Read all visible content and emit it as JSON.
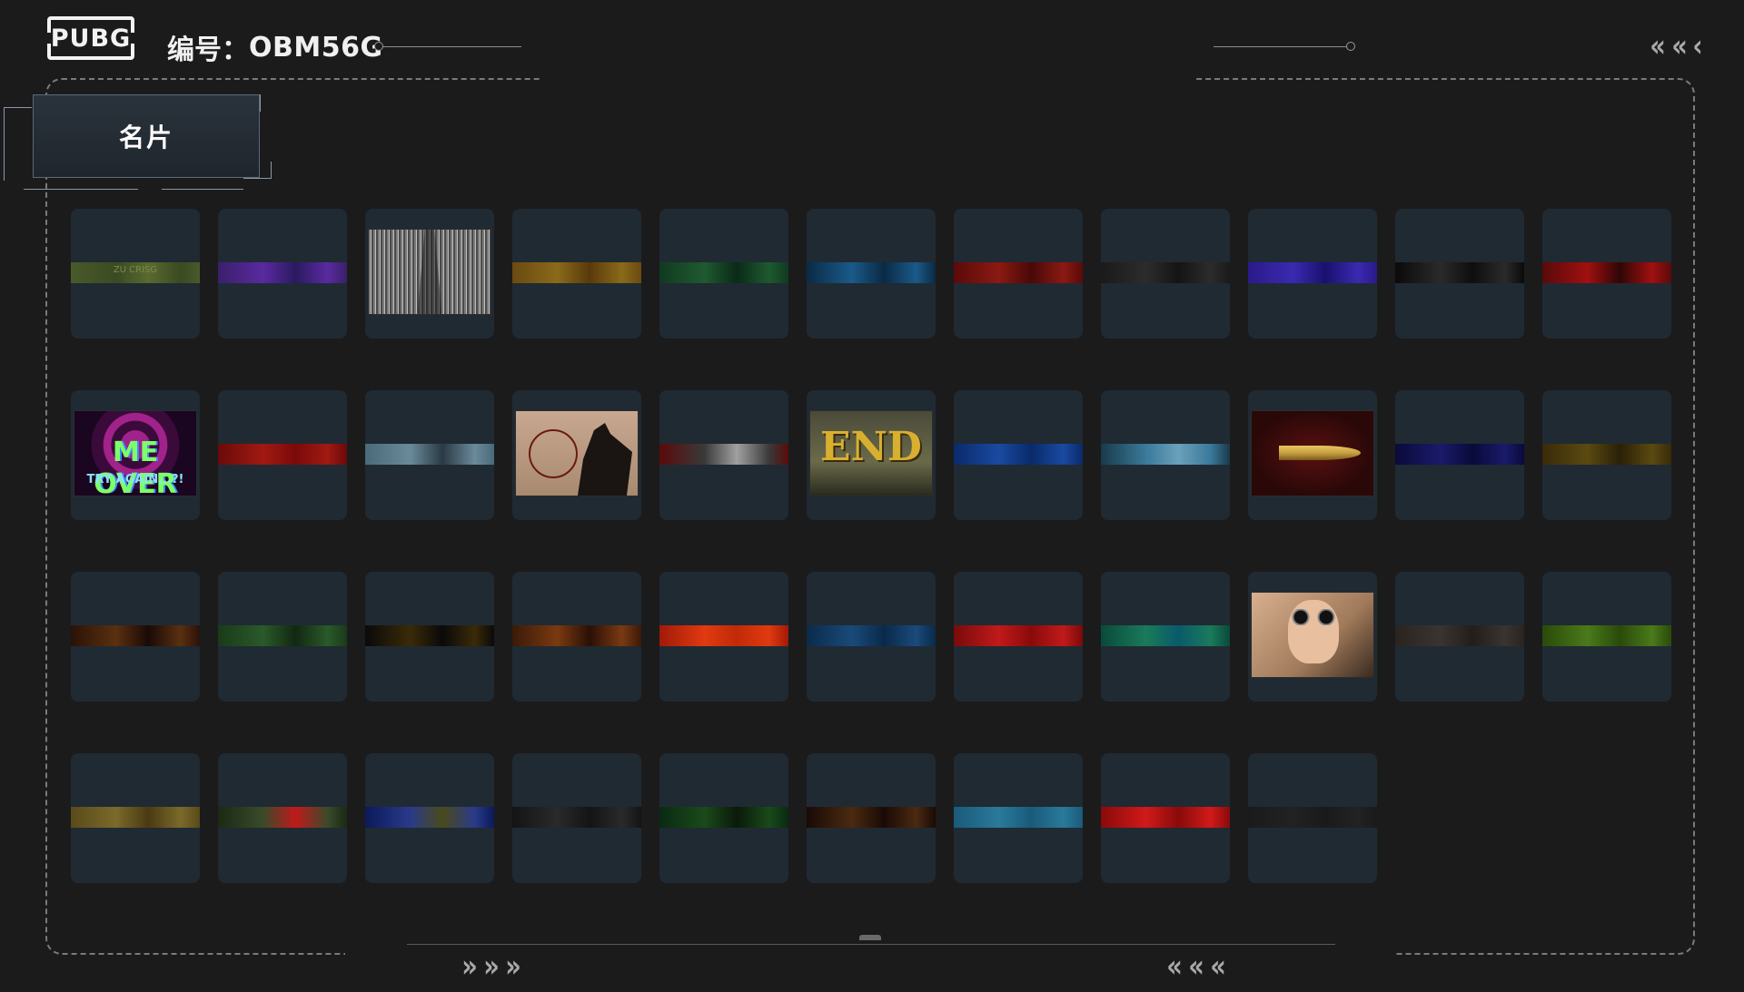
{
  "header": {
    "logo_text": "PUBG",
    "id_label": "编号：",
    "id_value": "OBM56G"
  },
  "tab": {
    "label": "名片"
  },
  "colors": {
    "background": "#1b1b1c",
    "card": "#202a33",
    "frame": "#7a7a7a"
  },
  "icons": {
    "back": "double-chevron-left-icon",
    "nav_right": "chevron-right-icon",
    "nav_left": "chevron-left-icon"
  },
  "cards": [
    {
      "stripe": [
        "#4a5a2a",
        "#3a4a22",
        "#5a6a30"
      ],
      "stripe_text": "ZU CRISG"
    },
    {
      "stripe": [
        "#3a1f6a",
        "#5a2aa0",
        "#2a1a60"
      ]
    },
    {
      "image": "noise",
      "colors": [
        "#7a7a7a",
        "#bdbdbd",
        "#4a4a4a"
      ]
    },
    {
      "stripe": [
        "#6a4a10",
        "#8a6a1a",
        "#5a3a0a"
      ]
    },
    {
      "stripe": [
        "#103a20",
        "#1f5a30",
        "#0a2a18"
      ]
    },
    {
      "stripe": [
        "#0a2a45",
        "#1a5a8a",
        "#0a2a45"
      ]
    },
    {
      "stripe": [
        "#5a0a0a",
        "#8a1a12",
        "#4a0808"
      ]
    },
    {
      "stripe": [
        "#1a1a1a",
        "#2c2c2c",
        "#141414"
      ]
    },
    {
      "stripe": [
        "#2a1a8a",
        "#3a2ab0",
        "#1a1070"
      ]
    },
    {
      "stripe": [
        "#0a0a0a",
        "#2a2a2a",
        "#0e0e0e"
      ]
    },
    {
      "stripe": [
        "#5a0a0a",
        "#a01010",
        "#300606"
      ]
    },
    {
      "image": "gameover",
      "text": "ME OVER",
      "subtext": "TRY AGAIN...?!",
      "colors": [
        "#3a0a3a",
        "#a0228a",
        "#1a0620"
      ]
    },
    {
      "stripe": [
        "#6a0a0a",
        "#a01a12",
        "#7a0a0a"
      ]
    },
    {
      "stripe": [
        "#4a6a7a",
        "#6a8a9a",
        "#2a3a44"
      ]
    },
    {
      "image": "sniper",
      "colors": [
        "#a88a70",
        "#c8a890",
        "#1a1412"
      ]
    },
    {
      "stripe": [
        "#5a0a0a",
        "#3a3a3a",
        "#a0a0a0"
      ]
    },
    {
      "image": "end",
      "text": "END",
      "colors": [
        "#4a4a3a",
        "#6a6a4a",
        "#d8b030"
      ]
    },
    {
      "stripe": [
        "#0a2a6a",
        "#1a4aa0",
        "#0a2a6a"
      ]
    },
    {
      "stripe": [
        "#1a3a4a",
        "#3a7a9a",
        "#6aa0ba"
      ]
    },
    {
      "image": "bullet",
      "colors": [
        "#2a0808",
        "#5a1010",
        "#c8a040"
      ]
    },
    {
      "stripe": [
        "#0a0a3a",
        "#1a1a6a",
        "#0a0a3a"
      ]
    },
    {
      "stripe": [
        "#3a2a0a",
        "#5a4a10",
        "#2a2008"
      ]
    },
    {
      "stripe": [
        "#2a1208",
        "#5a3010",
        "#1a0a06"
      ]
    },
    {
      "stripe": [
        "#1a3a1a",
        "#2a5a2a",
        "#122812"
      ]
    },
    {
      "stripe": [
        "#0a0a0a",
        "#3a2a08",
        "#0a0a0a"
      ]
    },
    {
      "stripe": [
        "#3a1a08",
        "#7a3a10",
        "#2a1006"
      ]
    },
    {
      "stripe": [
        "#a01a08",
        "#e03a10",
        "#c02a08"
      ]
    },
    {
      "stripe": [
        "#0a2a4a",
        "#1a4a7a",
        "#0a2a4a"
      ]
    },
    {
      "stripe": [
        "#7a0a0a",
        "#c01a1a",
        "#8a0a0a"
      ]
    },
    {
      "stripe": [
        "#0a4a3a",
        "#1a7a5a",
        "#0a5a6a"
      ]
    },
    {
      "image": "pilot",
      "colors": [
        "#a07a5a",
        "#d8b090",
        "#3a2a20"
      ]
    },
    {
      "stripe": [
        "#2a2420",
        "#3a3430",
        "#221e1a"
      ]
    },
    {
      "stripe": [
        "#2a4a0a",
        "#4a7a1a",
        "#2a4a0a"
      ]
    },
    {
      "stripe": [
        "#5a4a1a",
        "#7a6a2a",
        "#4a3a12"
      ]
    },
    {
      "stripe": [
        "#1a2a14",
        "#3a4a2a",
        "#c01a1a"
      ]
    },
    {
      "stripe": [
        "#0a1a5a",
        "#2a3a8a",
        "#4a4a1a"
      ]
    },
    {
      "stripe": [
        "#141414",
        "#2a2a2a",
        "#141414"
      ]
    },
    {
      "stripe": [
        "#0a2a12",
        "#1a4a1a",
        "#0a1a0a"
      ]
    },
    {
      "stripe": [
        "#1a0a06",
        "#4a2a10",
        "#1a0a06"
      ]
    },
    {
      "stripe": [
        "#1a5a7a",
        "#2a7a9a",
        "#1a5a7a"
      ]
    },
    {
      "stripe": [
        "#8a0a0a",
        "#d01a1a",
        "#8a0a0a"
      ]
    },
    {
      "stripe": [
        "#1a1a1a",
        "#222222",
        "#1a1a1a"
      ]
    }
  ]
}
